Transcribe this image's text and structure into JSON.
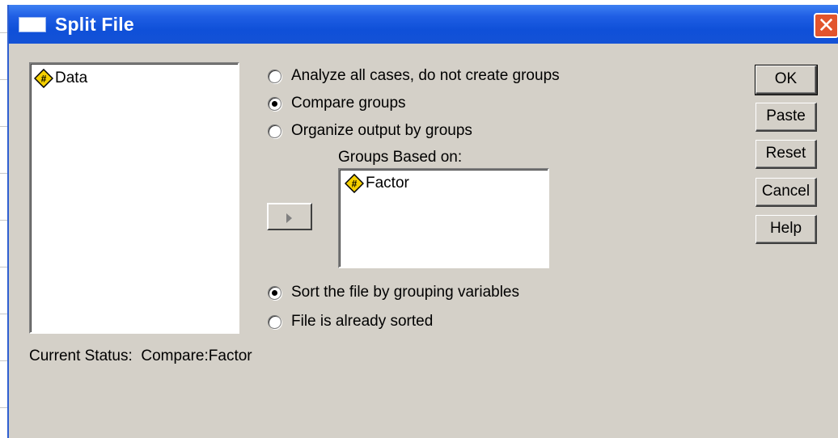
{
  "window": {
    "title": "Split File",
    "close_glyph": "✕"
  },
  "source_list": {
    "items": [
      {
        "label": "Data",
        "icon": "scale-variable-icon"
      }
    ]
  },
  "options": {
    "analyze_all": "Analyze all cases, do not create groups",
    "compare_groups": "Compare groups",
    "organize_output": "Organize output by groups",
    "selected": "compare_groups"
  },
  "groups": {
    "label": "Groups Based on:",
    "items": [
      {
        "label": "Factor",
        "icon": "scale-variable-icon"
      }
    ]
  },
  "sort": {
    "sort_by_grouping": "Sort the file by grouping variables",
    "already_sorted": "File is already sorted",
    "selected": "sort_by_grouping"
  },
  "status": {
    "label": "Current Status:",
    "value": "Compare:Factor"
  },
  "buttons": {
    "ok": "OK",
    "paste": "Paste",
    "reset": "Reset",
    "cancel": "Cancel",
    "help": "Help"
  },
  "colors": {
    "titlebar": "#0f50d8",
    "dialog_bg": "#d4d0c8",
    "variable_icon": "#f5d000"
  }
}
